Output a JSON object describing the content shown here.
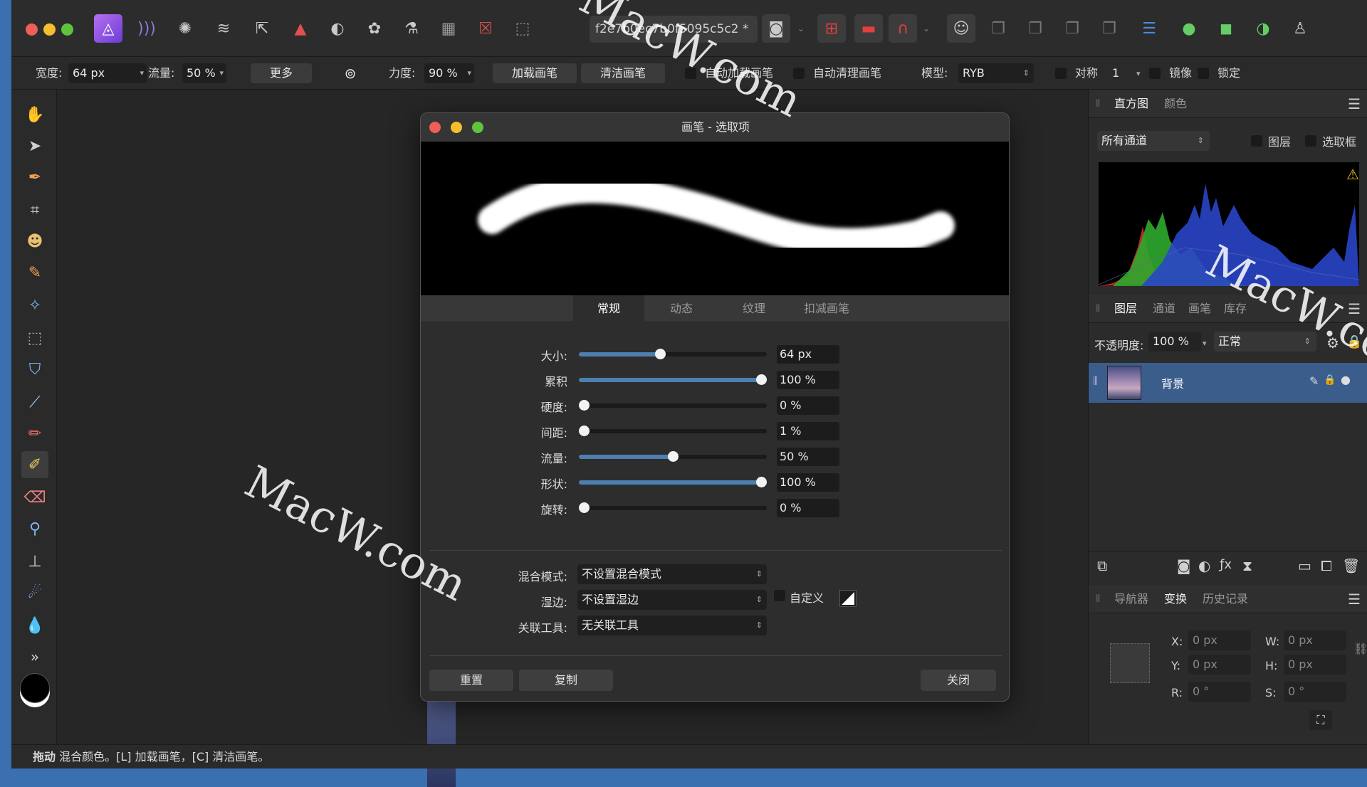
{
  "toolbar": {
    "document_name": "f2e7b0ec7b0f5095c5c2",
    "document_modified": "*"
  },
  "context": {
    "width_label": "宽度:",
    "width_value": "64 px",
    "flow_label": "流量:",
    "flow_value": "50 %",
    "more_button": "更多",
    "strength_label": "力度:",
    "strength_value": "90 %",
    "load_brush": "加载画笔",
    "clean_brush": "清洁画笔",
    "auto_load": "自动加载画笔",
    "auto_clean": "自动清理画笔",
    "model_label": "模型:",
    "model_value": "RYB",
    "symmetry_label": "对称",
    "symmetry_value": "1",
    "mirror_label": "镜像",
    "lock_label": "锁定"
  },
  "dialog": {
    "title": "画笔 - 选取项",
    "tabs": [
      "常规",
      "动态",
      "纹理",
      "扣减画笔"
    ],
    "sliders": [
      {
        "label": "大小:",
        "value": "64 px",
        "level": 0.43
      },
      {
        "label": "累积",
        "value": "100 %",
        "level": 1.0
      },
      {
        "label": "硬度:",
        "value": "0 %",
        "level": 0.0
      },
      {
        "label": "间距:",
        "value": "1 %",
        "level": 0.0
      },
      {
        "label": "流量:",
        "value": "50 %",
        "level": 0.5
      },
      {
        "label": "形状:",
        "value": "100 %",
        "level": 1.0
      },
      {
        "label": "旋转:",
        "value": "0 %",
        "level": 0.0
      }
    ],
    "blend_label": "混合模式:",
    "blend_value": "不设置混合模式",
    "wet_label": "湿边:",
    "wet_value": "不设置湿边",
    "custom_label": "自定义",
    "link_label": "关联工具:",
    "link_value": "无关联工具",
    "reset": "重置",
    "copy": "复制",
    "close": "关闭"
  },
  "histogram": {
    "tabs": [
      "直方图",
      "颜色"
    ],
    "channel": "所有通道",
    "layer_chk": "图层",
    "marquee_chk": "选取框"
  },
  "layers": {
    "tabs": [
      "图层",
      "通道",
      "画笔",
      "库存"
    ],
    "opacity_label": "不透明度:",
    "opacity_value": "100 %",
    "blend_mode": "正常",
    "layer_name": "背景"
  },
  "transform": {
    "tabs": [
      "导航器",
      "变换",
      "历史记录"
    ],
    "x_label": "X:",
    "x_value": "0 px",
    "y_label": "Y:",
    "y_value": "0 px",
    "w_label": "W:",
    "w_value": "0 px",
    "h_label": "H:",
    "h_value": "0 px",
    "r_label": "R:",
    "r_value": "0 °",
    "s_label": "S:",
    "s_value": "0 °"
  },
  "status": {
    "bold": "拖动",
    "text": " 混合颜色。[L] 加载画笔，[C] 清洁画笔。"
  },
  "watermark": "MacW.com"
}
